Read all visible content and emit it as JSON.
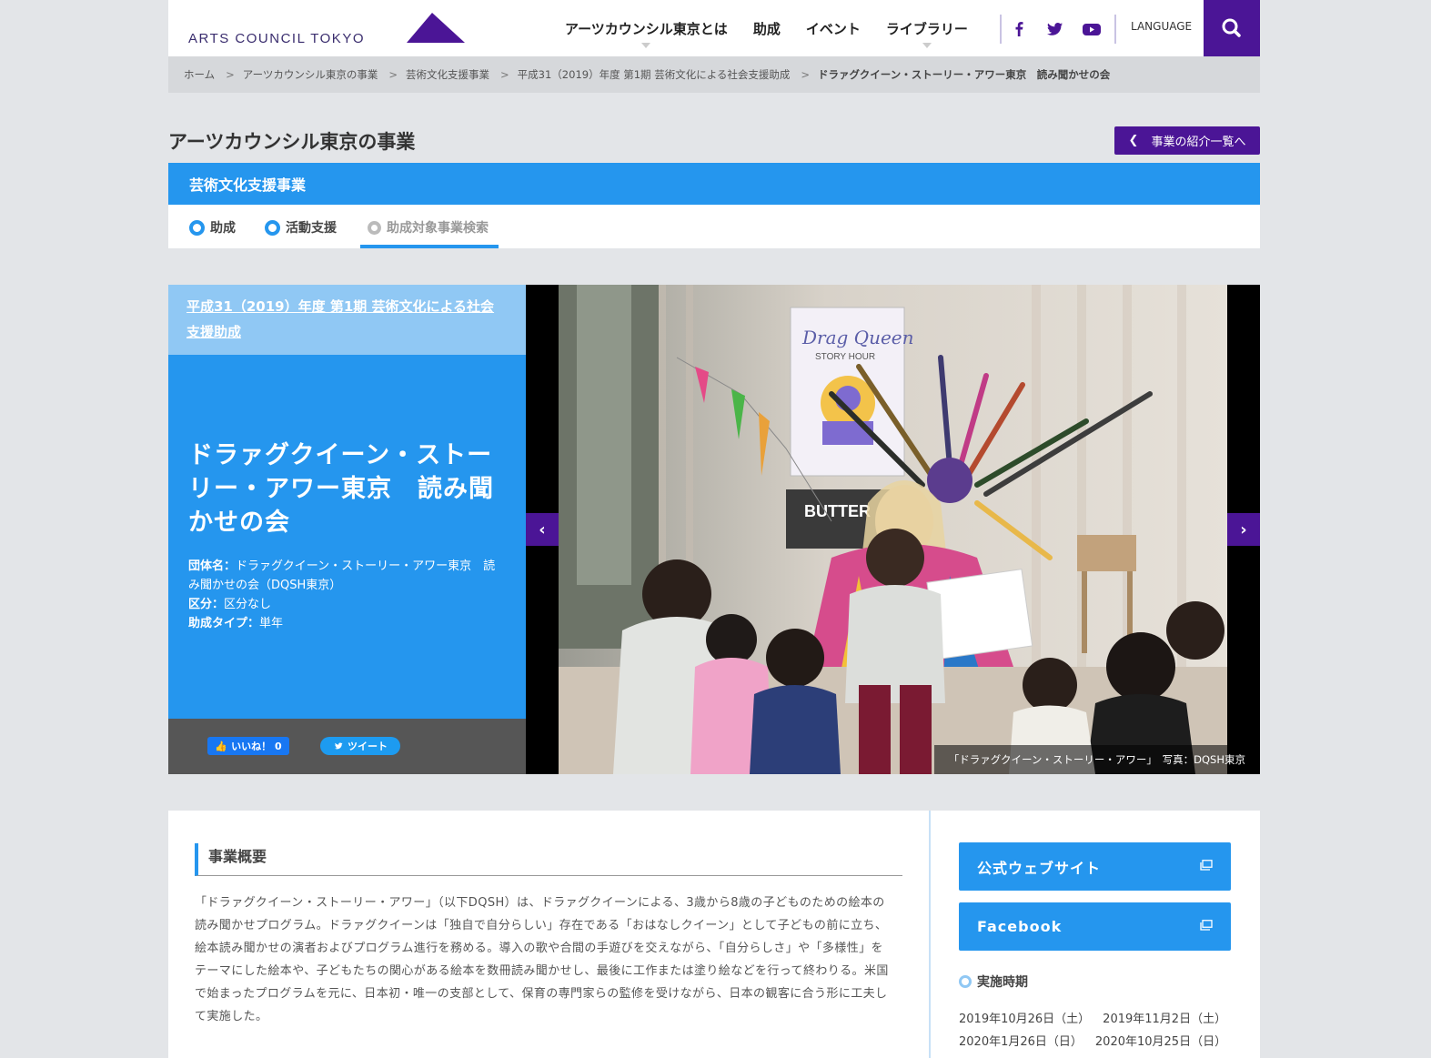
{
  "header": {
    "logo_text": "ARTS COUNCIL TOKYO",
    "nav": [
      {
        "label": "アーツカウンシル東京とは",
        "has_menu": true
      },
      {
        "label": "助成",
        "has_menu": false
      },
      {
        "label": "イベント",
        "has_menu": false
      },
      {
        "label": "ライブラリー",
        "has_menu": true
      }
    ],
    "social_icons": [
      "facebook-icon",
      "twitter-icon",
      "youtube-icon"
    ],
    "language_label": "LANGUAGE",
    "search_icon": "search-icon"
  },
  "breadcrumb": [
    "ホーム",
    "アーツカウンシル東京の事業",
    "芸術文化支援事業",
    "平成31（2019）年度 第1期 芸術文化による社会支援助成",
    "ドラァグクイーン・ストーリー・アワー東京　読み聞かせの会"
  ],
  "section": {
    "title": "アーツカウンシル東京の事業",
    "back_button": "事業の紹介一覧へ",
    "band_title": "芸術文化支援事業",
    "tabs": [
      {
        "label": "助成",
        "active": false
      },
      {
        "label": "活動支援",
        "active": false
      },
      {
        "label": "助成対象事業検索",
        "active": true
      }
    ]
  },
  "hero": {
    "tag_link": "平成31（2019）年度 第1期 芸術文化による社会支援助成",
    "title": "ドラァグクイーン・ストーリー・アワー東京　読み聞かせの会",
    "meta": [
      {
        "key": "団体名：",
        "value": "ドラァグクイーン・ストーリー・アワー東京　読み聞かせの会（DQSH東京）"
      },
      {
        "key": "区分：",
        "value": "区分なし"
      },
      {
        "key": "助成タイプ：",
        "value": "単年"
      }
    ],
    "like_label": "いいね！ 0",
    "tweet_label": "ツイート",
    "caption": "「ドラァグクイーン・ストーリー・アワー」　写真：DQSH東京",
    "sign_text": "Drag Queen",
    "sign_sub": "STORY HOUR",
    "shop_text": "BUTTER"
  },
  "content": {
    "outline_heading": "事業概要",
    "outline_text": "「ドラァグクイーン・ストーリー・アワー」（以下DQSH）は、ドラァグクイーンによる、3歳から8歳の子どものための絵本の読み聞かせプログラム。ドラァグクイーンは「独自で自分らしい」存在である「おはなしクイーン」として子どもの前に立ち、絵本読み聞かせの演者およびプログラム進行を務める。導入の歌や合間の手遊びを交えながら、「自分らしさ」や「多様性」をテーマにした絵本や、子どもたちの関心がある絵本を数冊読み聞かせし、最後に工作または塗り絵などを行って終わりる。米国で始まったプログラムを元に、日本初・唯一の支部として、保育の専門家らの監修を受けながら、日本の観客に合う形に工夫して実施した。",
    "side_buttons": [
      "公式ウェブサイト",
      "Facebook"
    ],
    "period_heading": "実施時期",
    "dates": [
      [
        "2019年10月26日（土）",
        "2019年11月2日（土）"
      ],
      [
        "2020年1月26日（日）",
        "2020年10月25日（日）"
      ]
    ]
  },
  "colors": {
    "brand_purple": "#4b1596",
    "accent_blue": "#2596ee",
    "light_blue": "#90c8f4"
  }
}
